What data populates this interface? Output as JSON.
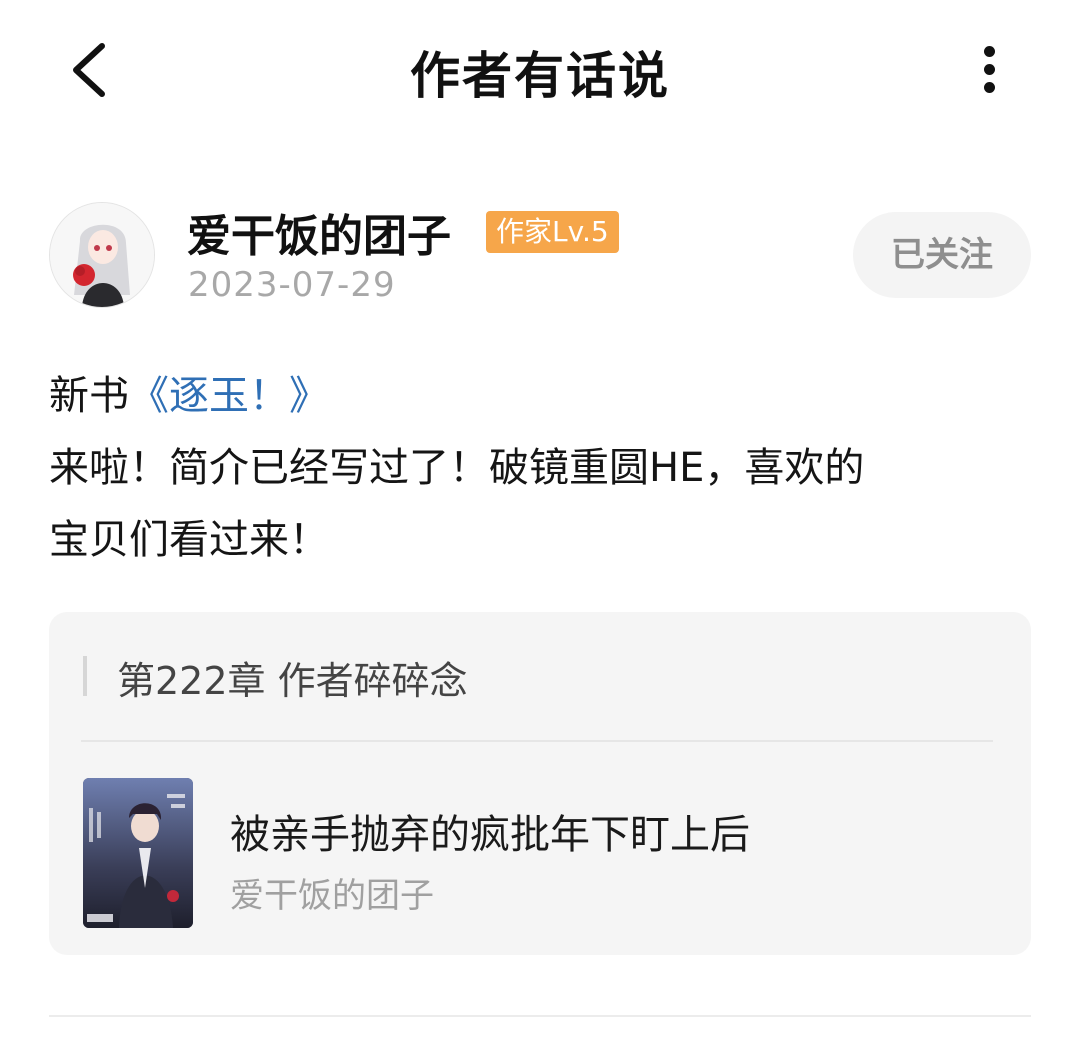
{
  "header": {
    "title": "作者有话说",
    "back_icon": "chevron-left-icon",
    "more_icon": "more-vertical-icon"
  },
  "author": {
    "name": "爱干饭的团子",
    "level_badge": "作家Lv.5",
    "date": "2023-07-29",
    "follow_label": "已关注",
    "badge_color": "#f6a64a"
  },
  "post": {
    "line1_prefix": "新书",
    "book_link": "《逐玉！》",
    "line2": "来啦！简介已经写过了！破镜重圆HE，喜欢的",
    "line3": "宝贝们看过来！",
    "link_color": "#2f6fb5"
  },
  "card": {
    "chapter_title": "第222章 作者碎碎念",
    "book_title": "被亲手抛弃的疯批年下盯上后",
    "book_author": "爱干饭的团子"
  }
}
